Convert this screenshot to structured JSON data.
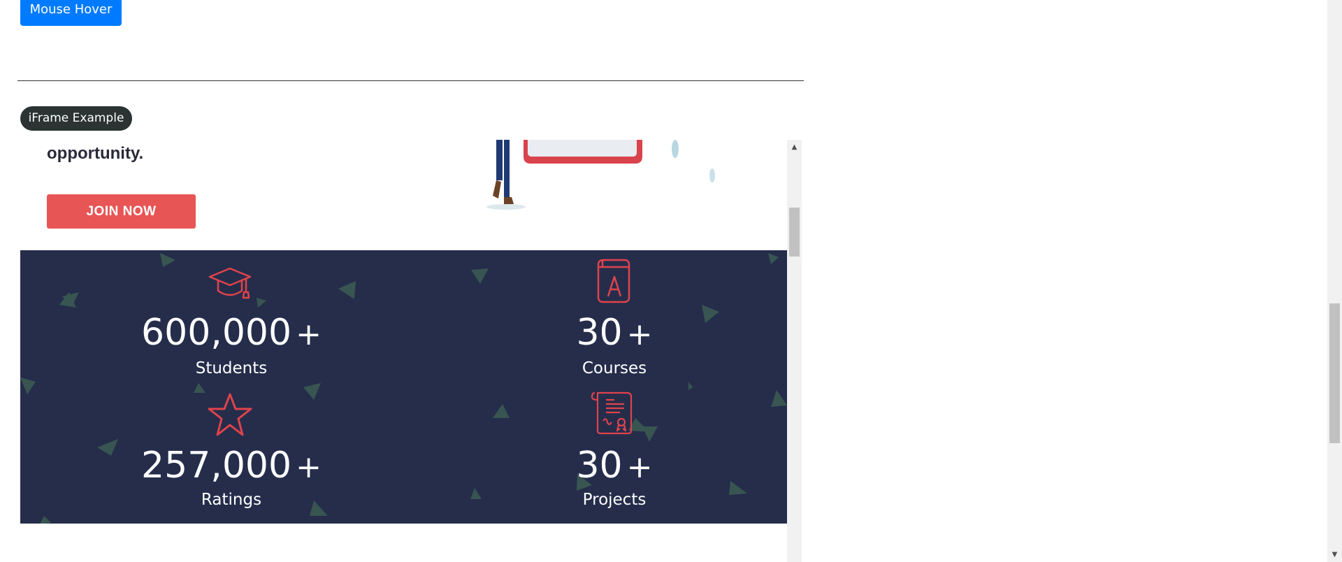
{
  "mouse_hover": {
    "label": "Mouse Hover"
  },
  "iframe_section": {
    "badge": "iFrame Example",
    "hero": {
      "text": "opportunity.",
      "join_button": "JOIN NOW"
    },
    "stats": [
      {
        "icon": "graduation-cap-icon",
        "value": "600,000",
        "suffix": "+",
        "label": "Students"
      },
      {
        "icon": "book-icon",
        "value": "30",
        "suffix": "+",
        "label": "Courses"
      },
      {
        "icon": "star-icon",
        "value": "257,000",
        "suffix": "+",
        "label": "Ratings"
      },
      {
        "icon": "certificate-icon",
        "value": "30",
        "suffix": "+",
        "label": "Projects"
      }
    ]
  },
  "colors": {
    "primary_button": "#007bff",
    "badge_bg": "#2b3333",
    "join_button": "#e85555",
    "stats_bg": "#252d4b",
    "icon_accent": "#e0434b"
  }
}
